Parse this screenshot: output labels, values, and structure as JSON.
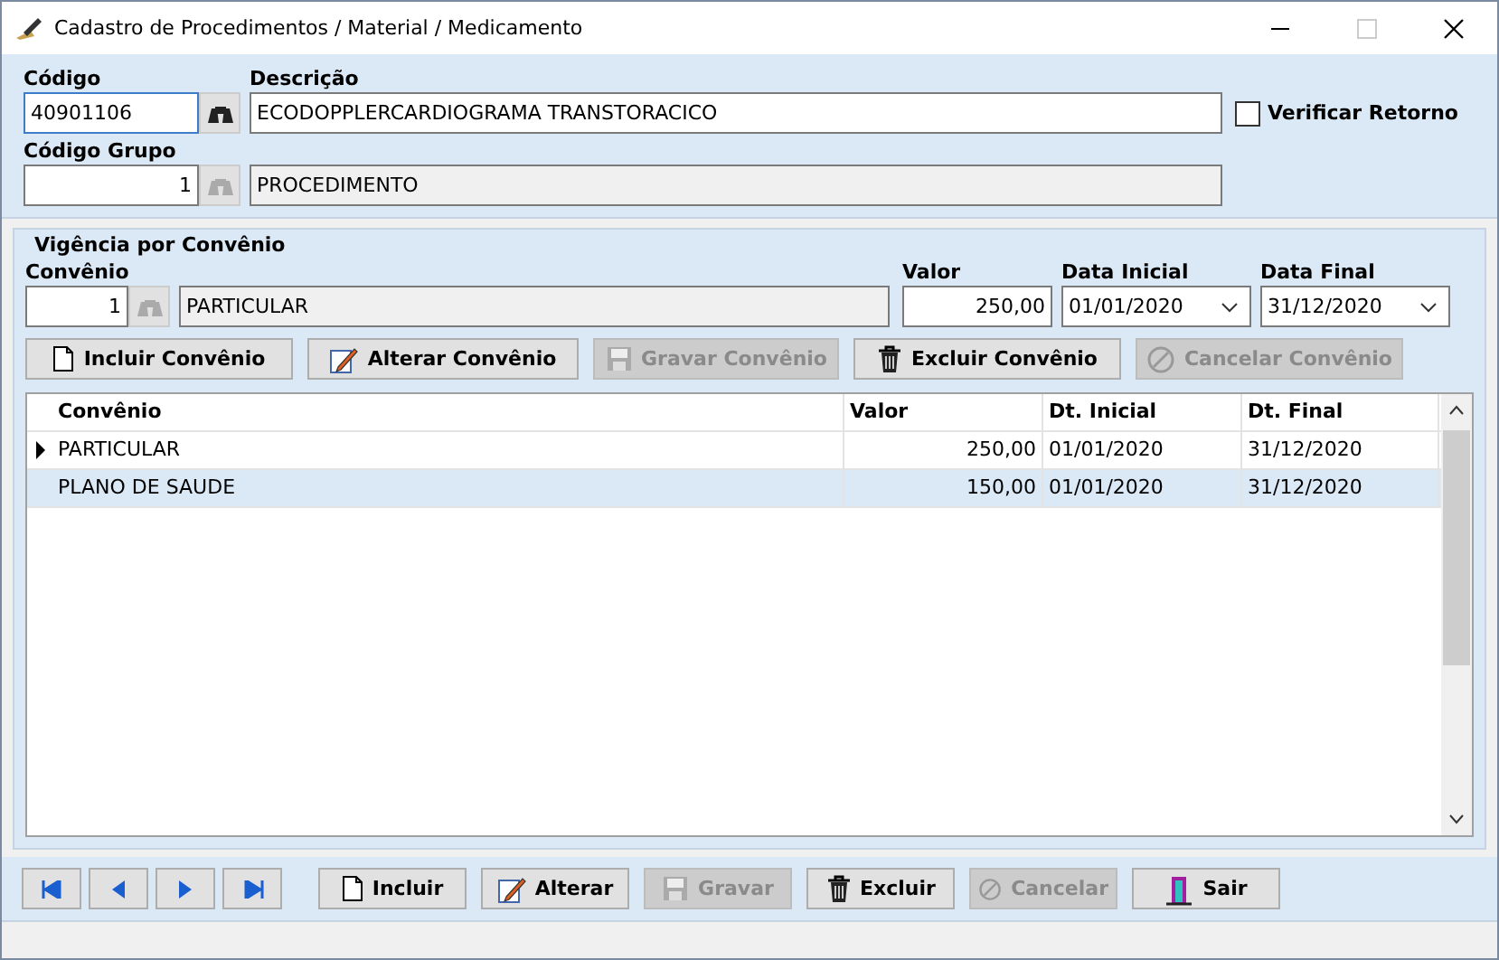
{
  "window": {
    "title": "Cadastro de Procedimentos / Material / Medicamento"
  },
  "header": {
    "codigo_label": "Código",
    "codigo": "40901106",
    "descricao_label": "Descrição",
    "descricao": "ECODOPPLERCARDIOGRAMA TRANSTORACICO",
    "verificar_retorno": {
      "label": "Verificar Retorno",
      "checked": false
    },
    "grupo_label": "Código Grupo",
    "grupo": "1",
    "grupo_nome": "PROCEDIMENTO"
  },
  "vigencia": {
    "title": "Vigência por Convênio",
    "convenio_label": "Convênio",
    "convenio": "1",
    "convenio_nome": "PARTICULAR",
    "valor_label": "Valor",
    "valor": "250,00",
    "data_inicial_label": "Data Inicial",
    "data_inicial": "01/01/2020",
    "data_final_label": "Data Final",
    "data_final": "31/12/2020",
    "buttons": [
      {
        "label": "Incluir Convênio",
        "kind": "new",
        "disabled": false
      },
      {
        "label": "Alterar Convênio",
        "kind": "edit",
        "disabled": false
      },
      {
        "label": "Gravar Convênio",
        "kind": "save",
        "disabled": true
      },
      {
        "label": "Excluir Convênio",
        "kind": "delete",
        "disabled": false
      },
      {
        "label": "Cancelar Convênio",
        "kind": "cancel",
        "disabled": true
      }
    ],
    "table": {
      "columns": [
        "Convênio",
        "Valor",
        "Dt. Inicial",
        "Dt. Final"
      ],
      "rows": [
        {
          "cells": [
            "PARTICULAR",
            "250,00",
            "01/01/2020",
            "31/12/2020"
          ],
          "current": true,
          "selected": false
        },
        {
          "cells": [
            "PLANO DE SAUDE",
            "150,00",
            "01/01/2020",
            "31/12/2020"
          ],
          "current": false,
          "selected": true
        }
      ]
    }
  },
  "navigation": [
    {
      "kind": "first"
    },
    {
      "kind": "prev"
    },
    {
      "kind": "next"
    },
    {
      "kind": "last"
    }
  ],
  "buttons": [
    {
      "label": "Incluir",
      "kind": "new",
      "disabled": false
    },
    {
      "label": "Alterar",
      "kind": "edit",
      "disabled": false
    },
    {
      "label": "Gravar",
      "kind": "save",
      "disabled": true
    },
    {
      "label": "Excluir",
      "kind": "delete",
      "disabled": false
    },
    {
      "label": "Cancelar",
      "kind": "cancel",
      "disabled": true
    },
    {
      "label": "Sair",
      "kind": "exit",
      "disabled": false
    }
  ]
}
